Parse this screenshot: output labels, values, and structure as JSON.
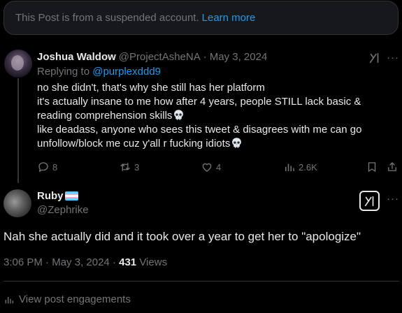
{
  "suspended_notice": {
    "text": "This Post is from a suspended account.",
    "link": "Learn more"
  },
  "reply": {
    "author_name": "Joshua Waldow",
    "author_handle": "@ProjectAsheNA",
    "date": "May 3, 2024",
    "replying_prefix": "Replying to",
    "replying_to": "@purplexddd9",
    "lines": [
      "no she didn't, that's why she still has her platform",
      "it's actually insane to me how after 4 years, people STILL lack basic &",
      "reading comprehension skills",
      "like deadass, anyone who sees this tweet & disagrees with me can go",
      "unfollow/block me cuz y'all r fucking idiots"
    ],
    "stats": {
      "replies": "8",
      "reposts": "3",
      "likes": "4",
      "views": "2.6K"
    }
  },
  "main_post": {
    "author_name": "Ruby",
    "author_handle": "@Zephrike",
    "text": "Nah she actually did and it took over a year to get her to \"apologize\"",
    "time": "3:06 PM",
    "date": "May 3, 2024",
    "views_count": "431",
    "views_label": "Views",
    "engagements_label": "View post engagements"
  },
  "colors": {
    "accent": "#1d9bf0",
    "muted": "#71767b",
    "text": "#e7e9ea",
    "background": "#000000"
  },
  "icons": [
    "grok-icon",
    "more-icon",
    "reply-icon",
    "repost-icon",
    "like-icon",
    "views-icon",
    "bookmark-icon",
    "share-icon",
    "skull-emoji",
    "trans-flag-emoji",
    "engagements-icon"
  ]
}
